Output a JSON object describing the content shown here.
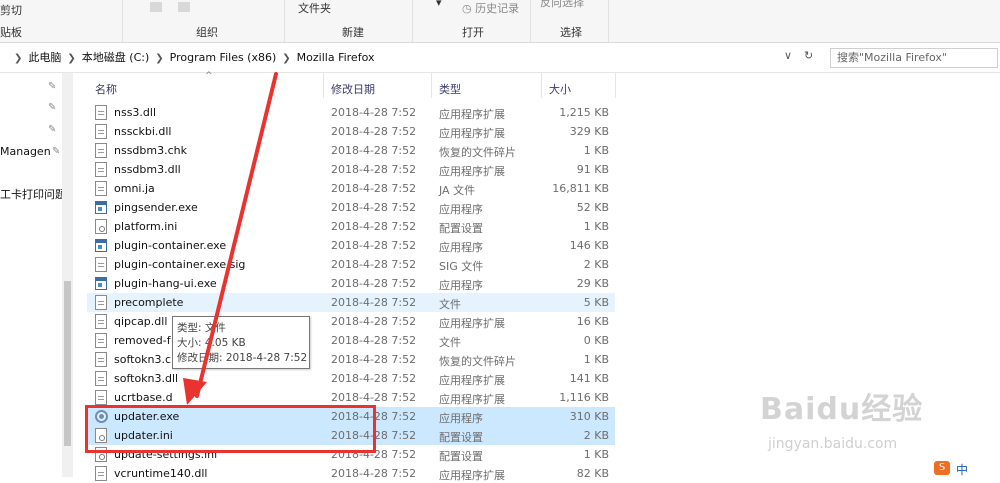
{
  "ribbon": {
    "cut": "剪切",
    "clipboard": "贴板",
    "organize": "组织",
    "folder": "文件夹",
    "new": "新建",
    "history": "历史记录",
    "open": "打开",
    "select": "选择",
    "invert_select": "反向选择"
  },
  "address": {
    "crumbs": [
      "此电脑",
      "本地磁盘 (C:)",
      "Program Files (x86)",
      "Mozilla Firefox"
    ],
    "search_placeholder": "搜索\"Mozilla Firefox\""
  },
  "nav": {
    "items": [
      "Managen",
      "工卡打印问题"
    ]
  },
  "columns": {
    "name": "名称",
    "date": "修改日期",
    "type": "类型",
    "size": "大小"
  },
  "files": [
    {
      "name": "nss3.dll",
      "date": "2018-4-28 7:52",
      "type": "应用程序扩展",
      "size": "1,215 KB",
      "icon": "doc-icon"
    },
    {
      "name": "nssckbi.dll",
      "date": "2018-4-28 7:52",
      "type": "应用程序扩展",
      "size": "329 KB",
      "icon": "doc-icon"
    },
    {
      "name": "nssdbm3.chk",
      "date": "2018-4-28 7:52",
      "type": "恢复的文件碎片",
      "size": "1 KB",
      "icon": "doc-icon"
    },
    {
      "name": "nssdbm3.dll",
      "date": "2018-4-28 7:52",
      "type": "应用程序扩展",
      "size": "91 KB",
      "icon": "doc-icon"
    },
    {
      "name": "omni.ja",
      "date": "2018-4-28 7:52",
      "type": "JA 文件",
      "size": "16,811 KB",
      "icon": "doc-icon"
    },
    {
      "name": "pingsender.exe",
      "date": "2018-4-28 7:52",
      "type": "应用程序",
      "size": "52 KB",
      "icon": "exe-icon"
    },
    {
      "name": "platform.ini",
      "date": "2018-4-28 7:52",
      "type": "配置设置",
      "size": "1 KB",
      "icon": "ini-icon"
    },
    {
      "name": "plugin-container.exe",
      "date": "2018-4-28 7:52",
      "type": "应用程序",
      "size": "146 KB",
      "icon": "exe-icon"
    },
    {
      "name": "plugin-container.exe.sig",
      "date": "2018-4-28 7:52",
      "type": "SIG 文件",
      "size": "2 KB",
      "icon": "doc-icon"
    },
    {
      "name": "plugin-hang-ui.exe",
      "date": "2018-4-28 7:52",
      "type": "应用程序",
      "size": "29 KB",
      "icon": "exe-icon"
    },
    {
      "name": "precomplete",
      "date": "2018-4-28 7:52",
      "type": "文件",
      "size": "5 KB",
      "icon": "doc-icon"
    },
    {
      "name": "qipcap.dll",
      "date": "2018-4-28 7:52",
      "type": "应用程序扩展",
      "size": "16 KB",
      "icon": "doc-icon"
    },
    {
      "name": "removed-f",
      "date": "2018-4-28 7:52",
      "type": "文件",
      "size": "0 KB",
      "icon": "doc-icon"
    },
    {
      "name": "softokn3.c",
      "date": "2018-4-28 7:52",
      "type": "恢复的文件碎片",
      "size": "1 KB",
      "icon": "doc-icon"
    },
    {
      "name": "softokn3.dll",
      "date": "2018-4-28 7:52",
      "type": "应用程序扩展",
      "size": "141 KB",
      "icon": "doc-icon"
    },
    {
      "name": "ucrtbase.d",
      "date": "2018-4-28 7:52",
      "type": "应用程序扩展",
      "size": "1,116 KB",
      "icon": "doc-icon"
    },
    {
      "name": "updater.exe",
      "date": "2018-4-28 7:52",
      "type": "应用程序",
      "size": "310 KB",
      "icon": "gear-icon"
    },
    {
      "name": "updater.ini",
      "date": "2018-4-28 7:52",
      "type": "配置设置",
      "size": "2 KB",
      "icon": "ini-icon"
    },
    {
      "name": "update-settings.ini",
      "date": "2018-4-28 7:52",
      "type": "配置设置",
      "size": "1 KB",
      "icon": "ini-icon"
    },
    {
      "name": "vcruntime140.dll",
      "date": "2018-4-28 7:52",
      "type": "应用程序扩展",
      "size": "82 KB",
      "icon": "doc-icon"
    }
  ],
  "tooltip": {
    "type_line": "类型: 文件",
    "size_line": "大小: 4.05 KB",
    "date_line": "修改日期: 2018-4-28 7:52"
  },
  "watermark": {
    "brand": "Baidu经验",
    "url": "jingyan.baidu.com"
  },
  "tray": {
    "ime_icon": "S",
    "ime_label": "中"
  },
  "colors": {
    "highlight_red": "#e8332f",
    "selected_row": "#cce8ff",
    "hover_row": "#e5f3ff"
  }
}
